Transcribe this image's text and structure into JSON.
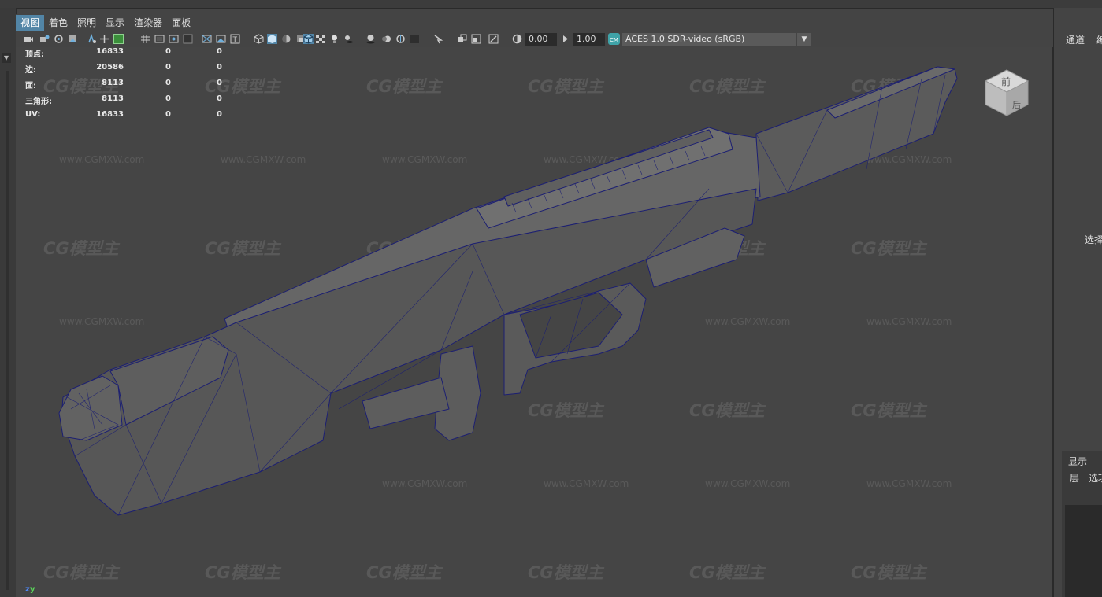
{
  "menu": {
    "items": [
      "视图",
      "着色",
      "照明",
      "显示",
      "渲染器",
      "面板"
    ]
  },
  "toolbar": {
    "exposure_value": "0.00",
    "gamma_value": "1.00",
    "color_space": "ACES 1.0 SDR-video (sRGB)",
    "icons": [
      "select-camera-icon",
      "camera-attributes-icon",
      "bookmarks-icon",
      "image-plane-icon",
      "2d-pan-zoom-icon",
      "grease-pencil-icon",
      "grid-icon",
      "film-gate-icon",
      "resolution-gate-icon",
      "gate-mask-icon",
      "field-chart-icon",
      "safe-action-icon",
      "safe-title-icon",
      "wireframe-icon",
      "smooth-shade-icon",
      "default-material-icon",
      "wireframe-on-shaded-icon",
      "xray-icon",
      "use-lights-icon",
      "shadows-icon",
      "ambient-occlusion-icon",
      "motion-blur-icon",
      "anti-aliasing-icon",
      "isolate-select-icon",
      "xray-joints-icon",
      "xray-active-components-icon",
      "exposure-icon",
      "gamma-icon",
      "color-management-icon"
    ]
  },
  "hud": {
    "rows": [
      {
        "label": "顶点:",
        "v1": "16833",
        "v2": "0",
        "v3": "0"
      },
      {
        "label": "边:",
        "v1": "20586",
        "v2": "0",
        "v3": "0"
      },
      {
        "label": "面:",
        "v1": "8113",
        "v2": "0",
        "v3": "0"
      },
      {
        "label": "三角形:",
        "v1": "8113",
        "v2": "0",
        "v3": "0"
      },
      {
        "label": "UV:",
        "v1": "16833",
        "v2": "0",
        "v3": "0"
      }
    ]
  },
  "viewcube": {
    "face_top": "前",
    "face_side": "后"
  },
  "watermark": {
    "logo": "CG模型主",
    "url": "www.CGMXW.com"
  },
  "axis": {
    "z": "z",
    "y": "y"
  },
  "right_panel": {
    "tab1": "通道",
    "tab2": "编",
    "select": "选择",
    "display_tab": "显示",
    "layer": "层",
    "options": "选项"
  },
  "colors": {
    "accent": "#5285a6",
    "wireframe": "#1c1f72",
    "mesh_fill": "#5b5b5b",
    "viewport_bg": "#454545"
  }
}
